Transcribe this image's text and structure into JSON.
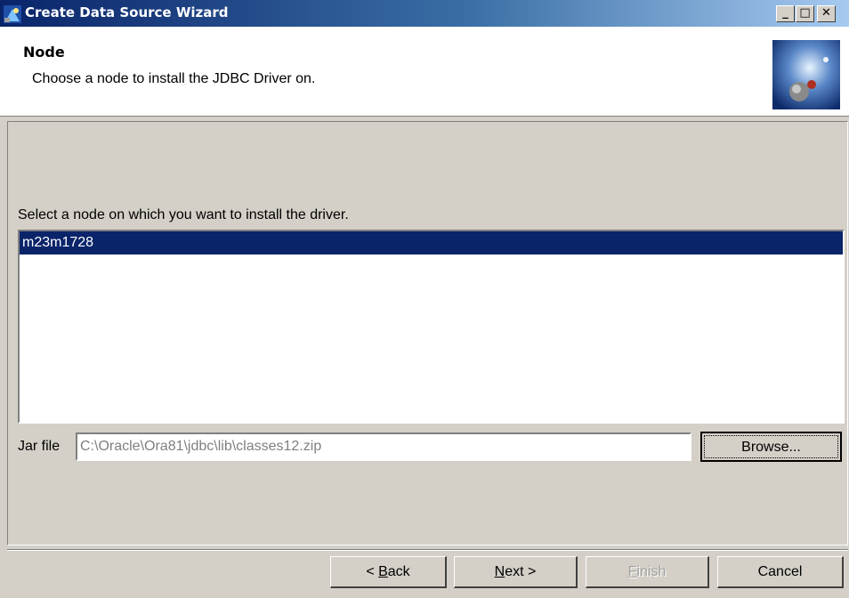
{
  "window": {
    "title": "Create Data Source Wizard",
    "controls": {
      "minimize": "_",
      "maximize": "□",
      "close": "✕"
    }
  },
  "header": {
    "title": "Node",
    "subtitle": "Choose a node to install the JDBC Driver on."
  },
  "main": {
    "prompt": "Select a node on which you want to install the driver.",
    "nodes": [
      "m23m1728"
    ],
    "selected_node_index": 0,
    "jar_file_label": "Jar file",
    "jar_file_value": "C:\\Oracle\\Ora81\\jdbc\\lib\\classes12.zip",
    "browse_label": "Browse..."
  },
  "footer": {
    "back": {
      "prefix": "< ",
      "mnemonic": "B",
      "rest": "ack"
    },
    "next": {
      "mnemonic": "N",
      "rest": "ext >"
    },
    "finish": {
      "mnemonic": "F",
      "rest": "inish"
    },
    "cancel": "Cancel"
  },
  "colors": {
    "selection": "#0a246a",
    "titlebar_start": "#0a246a",
    "titlebar_end": "#a6caf0",
    "dialog_bg": "#d4d0c8"
  },
  "icons": {
    "window": "wizard-app-icon",
    "header": "globe-graphic"
  }
}
